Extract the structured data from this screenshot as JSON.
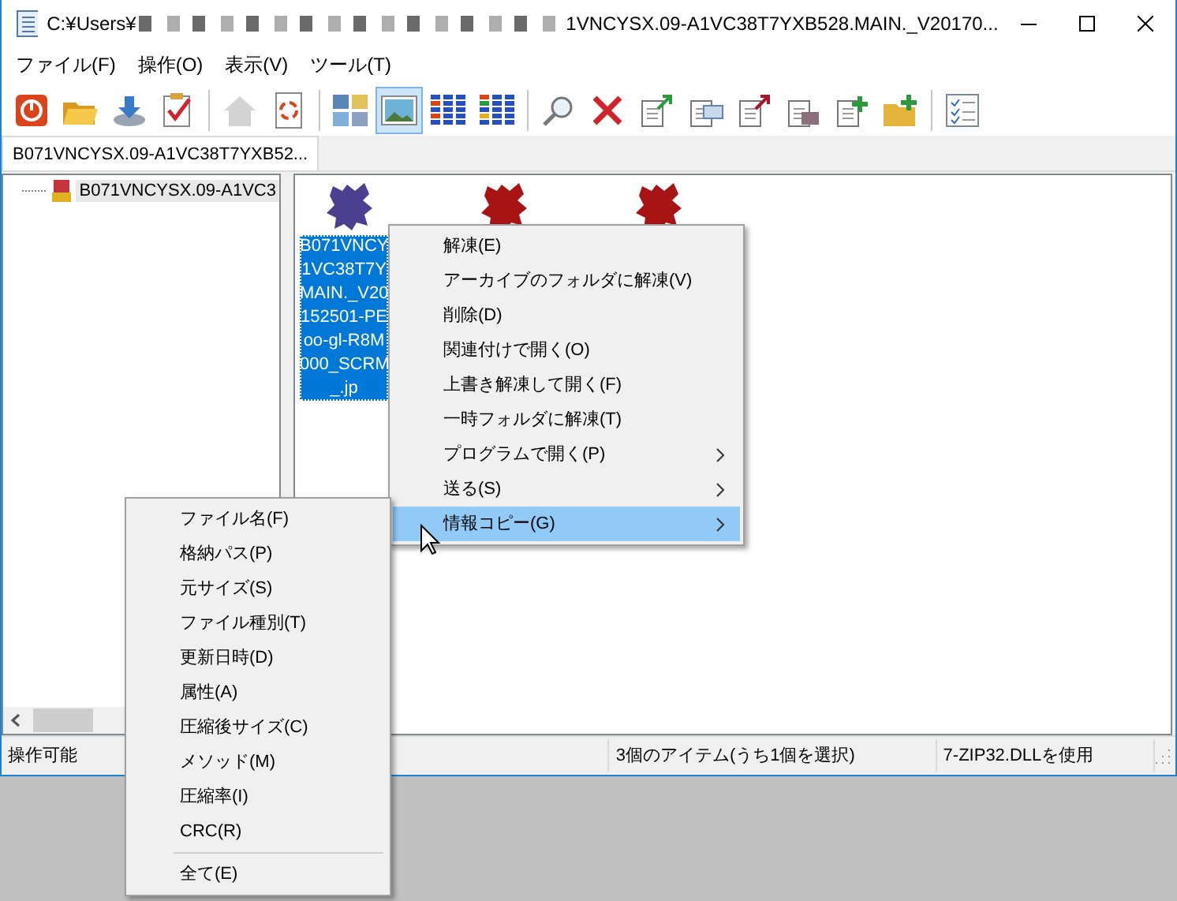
{
  "window": {
    "title_start": "C:¥Users¥",
    "title_end": "1VNCYSX.09-A1VC38T7YXB528.MAIN._V20170..."
  },
  "menu_bar": [
    "ファイル(F)",
    "操作(O)",
    "表示(V)",
    "ツール(T)"
  ],
  "toolbar": [
    [
      {
        "kind": "power",
        "pressed": false,
        "disabled": false
      },
      {
        "kind": "open",
        "pressed": false,
        "disabled": false
      },
      {
        "kind": "extract",
        "pressed": false,
        "disabled": false
      },
      {
        "kind": "check",
        "pressed": false,
        "disabled": false
      }
    ],
    [
      {
        "kind": "home",
        "pressed": false,
        "disabled": true
      },
      {
        "kind": "refresh",
        "pressed": false,
        "disabled": false
      }
    ],
    [
      {
        "kind": "icons",
        "pressed": false,
        "disabled": false
      },
      {
        "kind": "thumbs",
        "pressed": true,
        "disabled": false
      },
      {
        "kind": "list",
        "pressed": false,
        "disabled": false
      },
      {
        "kind": "details",
        "pressed": false,
        "disabled": false
      }
    ],
    [
      {
        "kind": "search",
        "pressed": false,
        "disabled": false
      },
      {
        "kind": "delete",
        "pressed": false,
        "disabled": false
      },
      {
        "kind": "docgreen",
        "pressed": false,
        "disabled": false
      },
      {
        "kind": "docwin",
        "pressed": false,
        "disabled": false
      },
      {
        "kind": "docred",
        "pressed": false,
        "disabled": false
      },
      {
        "kind": "docpic",
        "pressed": false,
        "disabled": false
      },
      {
        "kind": "docplus",
        "pressed": false,
        "disabled": false
      },
      {
        "kind": "folderplus",
        "pressed": false,
        "disabled": false
      }
    ],
    [
      {
        "kind": "checklist",
        "pressed": false,
        "disabled": false
      }
    ]
  ],
  "tabs": [
    {
      "label": "B071VNCYSX.09-A1VC38T7YXB52...",
      "selected": true
    }
  ],
  "tree": [
    {
      "label": "B071VNCYSX.09-A1VC3",
      "selected": true
    }
  ],
  "files": [
    {
      "label_lines": [
        "B071VNCY",
        "1VC38T7Y",
        "MAIN._V20",
        "152501-PE",
        "oo-gl-R8M",
        "000_SCRM",
        "_.jp"
      ],
      "selected": true
    },
    {
      "selected": false
    },
    {
      "selected": false
    }
  ],
  "context_menu": [
    {
      "label": "解凍(E)",
      "submenu": false,
      "selected": false
    },
    {
      "label": "アーカイブのフォルダに解凍(V)",
      "submenu": false,
      "selected": false
    },
    {
      "label": "削除(D)",
      "submenu": false,
      "selected": false
    },
    {
      "label": "関連付けで開く(O)",
      "submenu": false,
      "selected": false
    },
    {
      "label": "上書き解凍して開く(F)",
      "submenu": false,
      "selected": false
    },
    {
      "label": "一時フォルダに解凍(T)",
      "submenu": false,
      "selected": false
    },
    {
      "label": "プログラムで開く(P)",
      "submenu": true,
      "selected": false
    },
    {
      "label": "送る(S)",
      "submenu": true,
      "selected": false
    },
    {
      "label": "情報コピー(G)",
      "submenu": true,
      "selected": true
    }
  ],
  "submenu": [
    {
      "label": "ファイル名(F)",
      "separator_before": false
    },
    {
      "label": "格納パス(P)",
      "separator_before": false
    },
    {
      "label": "元サイズ(S)",
      "separator_before": false
    },
    {
      "label": "ファイル種別(T)",
      "separator_before": false
    },
    {
      "label": "更新日時(D)",
      "separator_before": false
    },
    {
      "label": "属性(A)",
      "separator_before": false
    },
    {
      "label": "圧縮後サイズ(C)",
      "separator_before": false
    },
    {
      "label": "メソッド(M)",
      "separator_before": false
    },
    {
      "label": "圧縮率(I)",
      "separator_before": false
    },
    {
      "label": "CRC(R)",
      "separator_before": false
    },
    {
      "label": "全て(E)",
      "separator_before": true
    }
  ],
  "status_bar": {
    "state": "操作可能",
    "items": [
      "3個のアイテム(うち1個を選択)",
      "7-ZIP32.DLLを使用"
    ]
  }
}
